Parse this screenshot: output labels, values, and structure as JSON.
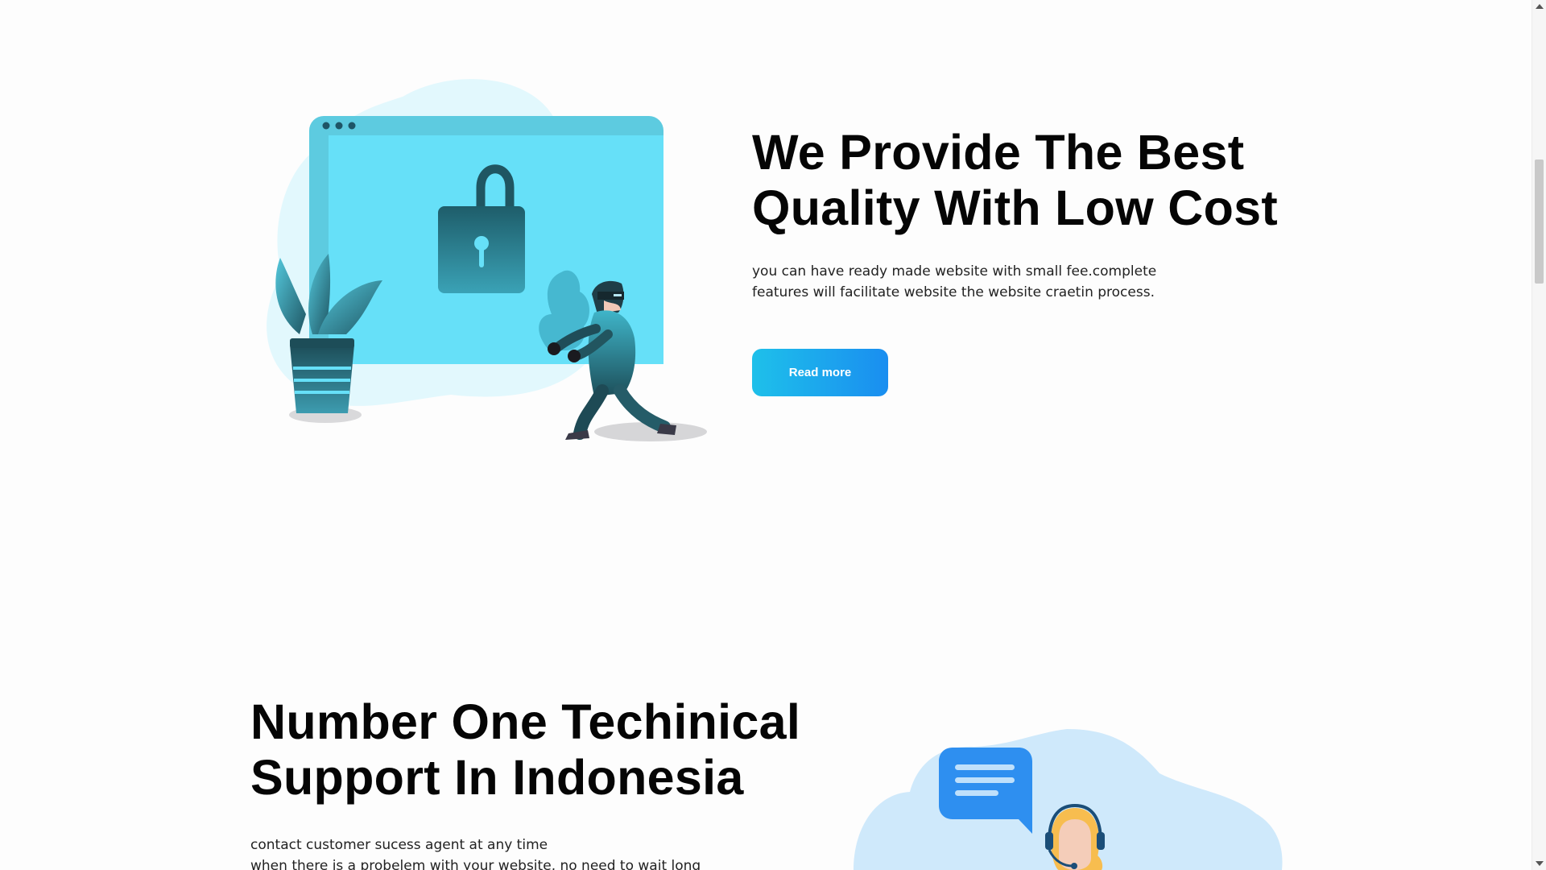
{
  "hero": {
    "title_line1": "We Provide The Best",
    "title_line2": "Quality With Low Cost",
    "description_line1": "you can have ready made website with small fee.complete",
    "description_line2": "features will facilitate website the website craetin process.",
    "button_label": "Read more",
    "illustration_icon": "security-lock-thief-illustration"
  },
  "support": {
    "title_line1": "Number One Techinical",
    "title_line2": "Support In Indonesia",
    "description_line1": "contact customer sucess agent at any time",
    "description_line2": "when there is a probelem with your website, no need to wait long",
    "illustration_icon": "customer-support-chat-illustration"
  },
  "colors": {
    "accent_start": "#1ec0ea",
    "accent_end": "#1a8ef0",
    "heading": "#050505",
    "screen_blue": "#66e0f8",
    "teal_dark": "#1f5560",
    "support_blob": "#cfe9fb",
    "chat_blue": "#2e8ff0"
  }
}
